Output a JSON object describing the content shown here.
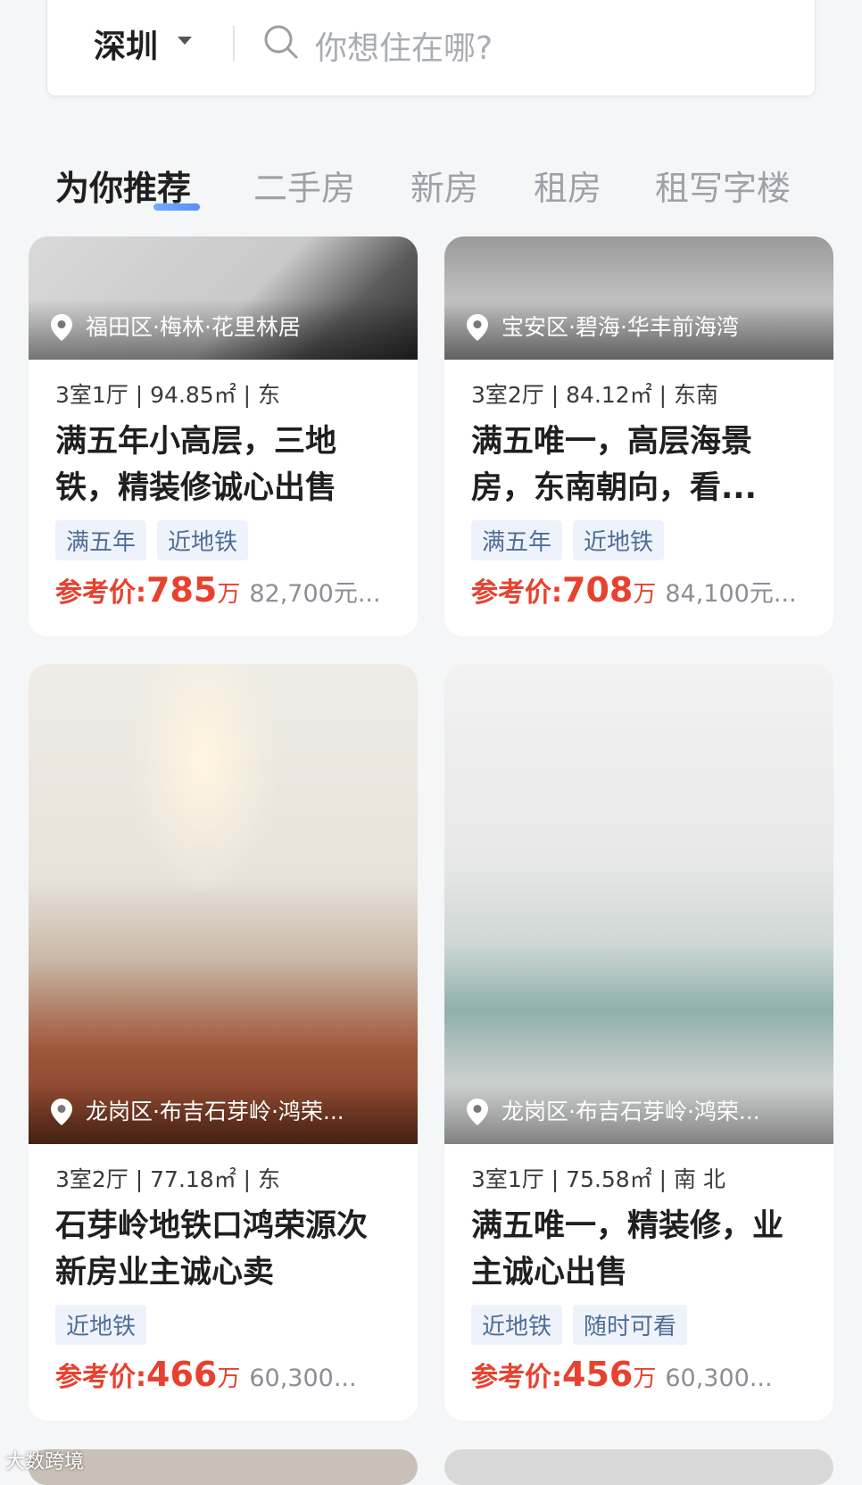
{
  "search": {
    "city": "深圳",
    "placeholder": "你想住在哪?"
  },
  "tabs": [
    {
      "label": "为你推荐"
    },
    {
      "label": "二手房"
    },
    {
      "label": "新房"
    },
    {
      "label": "租房"
    },
    {
      "label": "租写字楼"
    }
  ],
  "listings": [
    {
      "location": "福田区·梅林·花里林居",
      "meta": "3室1厅 | 94.85㎡ | 东",
      "title": "满五年小高层，三地铁，精装修诚心出售",
      "tags": [
        "满五年",
        "近地铁"
      ],
      "price_label": "参考价:",
      "price": "785",
      "price_unit": "万",
      "unit_price": "82,700元..."
    },
    {
      "location": "宝安区·碧海·华丰前海湾",
      "meta": "3室2厅 | 84.12㎡ | 东南",
      "title": "满五唯一，高层海景房，东南朝向，看...",
      "tags": [
        "满五年",
        "近地铁"
      ],
      "price_label": "参考价:",
      "price": "708",
      "price_unit": "万",
      "unit_price": "84,100元..."
    },
    {
      "location": "龙岗区·布吉石芽岭·鸿荣...",
      "meta": "3室2厅 | 77.18㎡ | 东",
      "title": "石芽岭地铁口鸿荣源次新房业主诚心卖",
      "tags": [
        "近地铁"
      ],
      "price_label": "参考价:",
      "price": "466",
      "price_unit": "万",
      "unit_price": "60,300..."
    },
    {
      "location": "龙岗区·布吉石芽岭·鸿荣...",
      "meta": "3室1厅 | 75.58㎡ | 南 北",
      "title": "满五唯一，精装修，业主诚心出售",
      "tags": [
        "近地铁",
        "随时可看"
      ],
      "price_label": "参考价:",
      "price": "456",
      "price_unit": "万",
      "unit_price": "60,300..."
    }
  ],
  "watermark": "大数跨境"
}
